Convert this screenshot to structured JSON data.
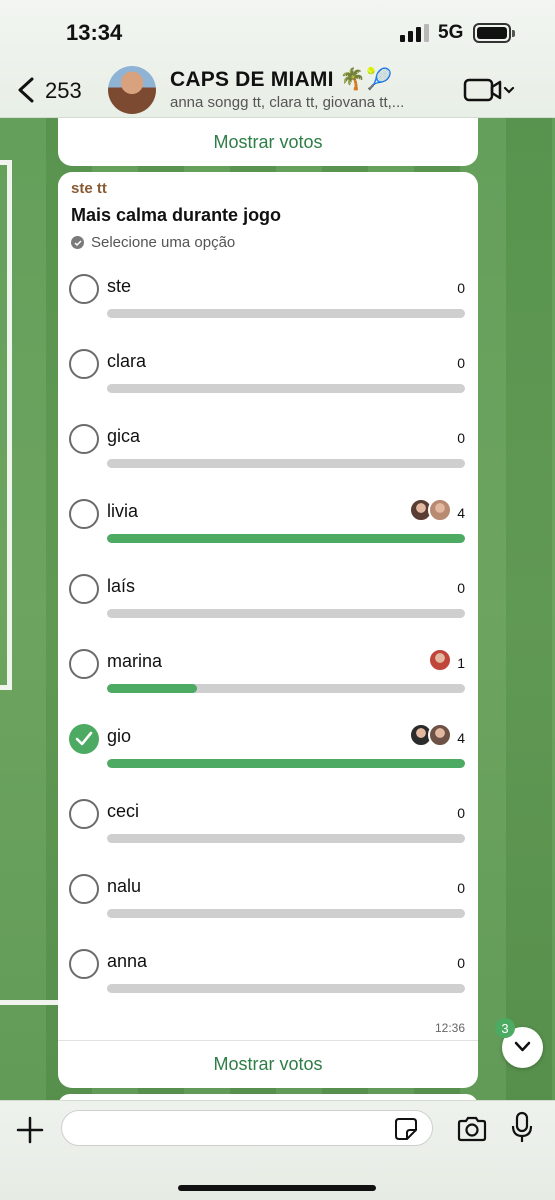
{
  "status": {
    "time": "13:34",
    "network": "5G"
  },
  "header": {
    "back_count": "253",
    "title": "CAPS DE MIAMI 🌴🎾",
    "subtitle": "anna songg tt, clara tt, giovana tt,..."
  },
  "prev_card": {
    "show_votes": "Mostrar votos"
  },
  "poll": {
    "sender": "ste tt",
    "question": "Mais calma durante jogo",
    "hint": "Selecione uma opção",
    "time": "12:36",
    "show_votes": "Mostrar votos",
    "options": [
      {
        "label": "ste",
        "count": "0",
        "fraction": 0,
        "selected": false,
        "voters": []
      },
      {
        "label": "clara",
        "count": "0",
        "fraction": 0,
        "selected": false,
        "voters": []
      },
      {
        "label": "gica",
        "count": "0",
        "fraction": 0,
        "selected": false,
        "voters": []
      },
      {
        "label": "livia",
        "count": "4",
        "fraction": 1,
        "selected": false,
        "voters": [
          "#5a3d33",
          "#b98a72"
        ]
      },
      {
        "label": "laís",
        "count": "0",
        "fraction": 0,
        "selected": false,
        "voters": []
      },
      {
        "label": "marina",
        "count": "1",
        "fraction": 0.25,
        "selected": false,
        "voters": [
          "#c0463b"
        ]
      },
      {
        "label": "gio",
        "count": "4",
        "fraction": 1,
        "selected": true,
        "voters": [
          "#2b2b2b",
          "#6e5246"
        ]
      },
      {
        "label": "ceci",
        "count": "0",
        "fraction": 0,
        "selected": false,
        "voters": []
      },
      {
        "label": "nalu",
        "count": "0",
        "fraction": 0,
        "selected": false,
        "voters": []
      },
      {
        "label": "anna",
        "count": "0",
        "fraction": 0,
        "selected": false,
        "voters": []
      }
    ]
  },
  "scroll": {
    "unread": "3"
  },
  "colors": {
    "accent": "#4caa63",
    "link": "#2f7d47"
  }
}
